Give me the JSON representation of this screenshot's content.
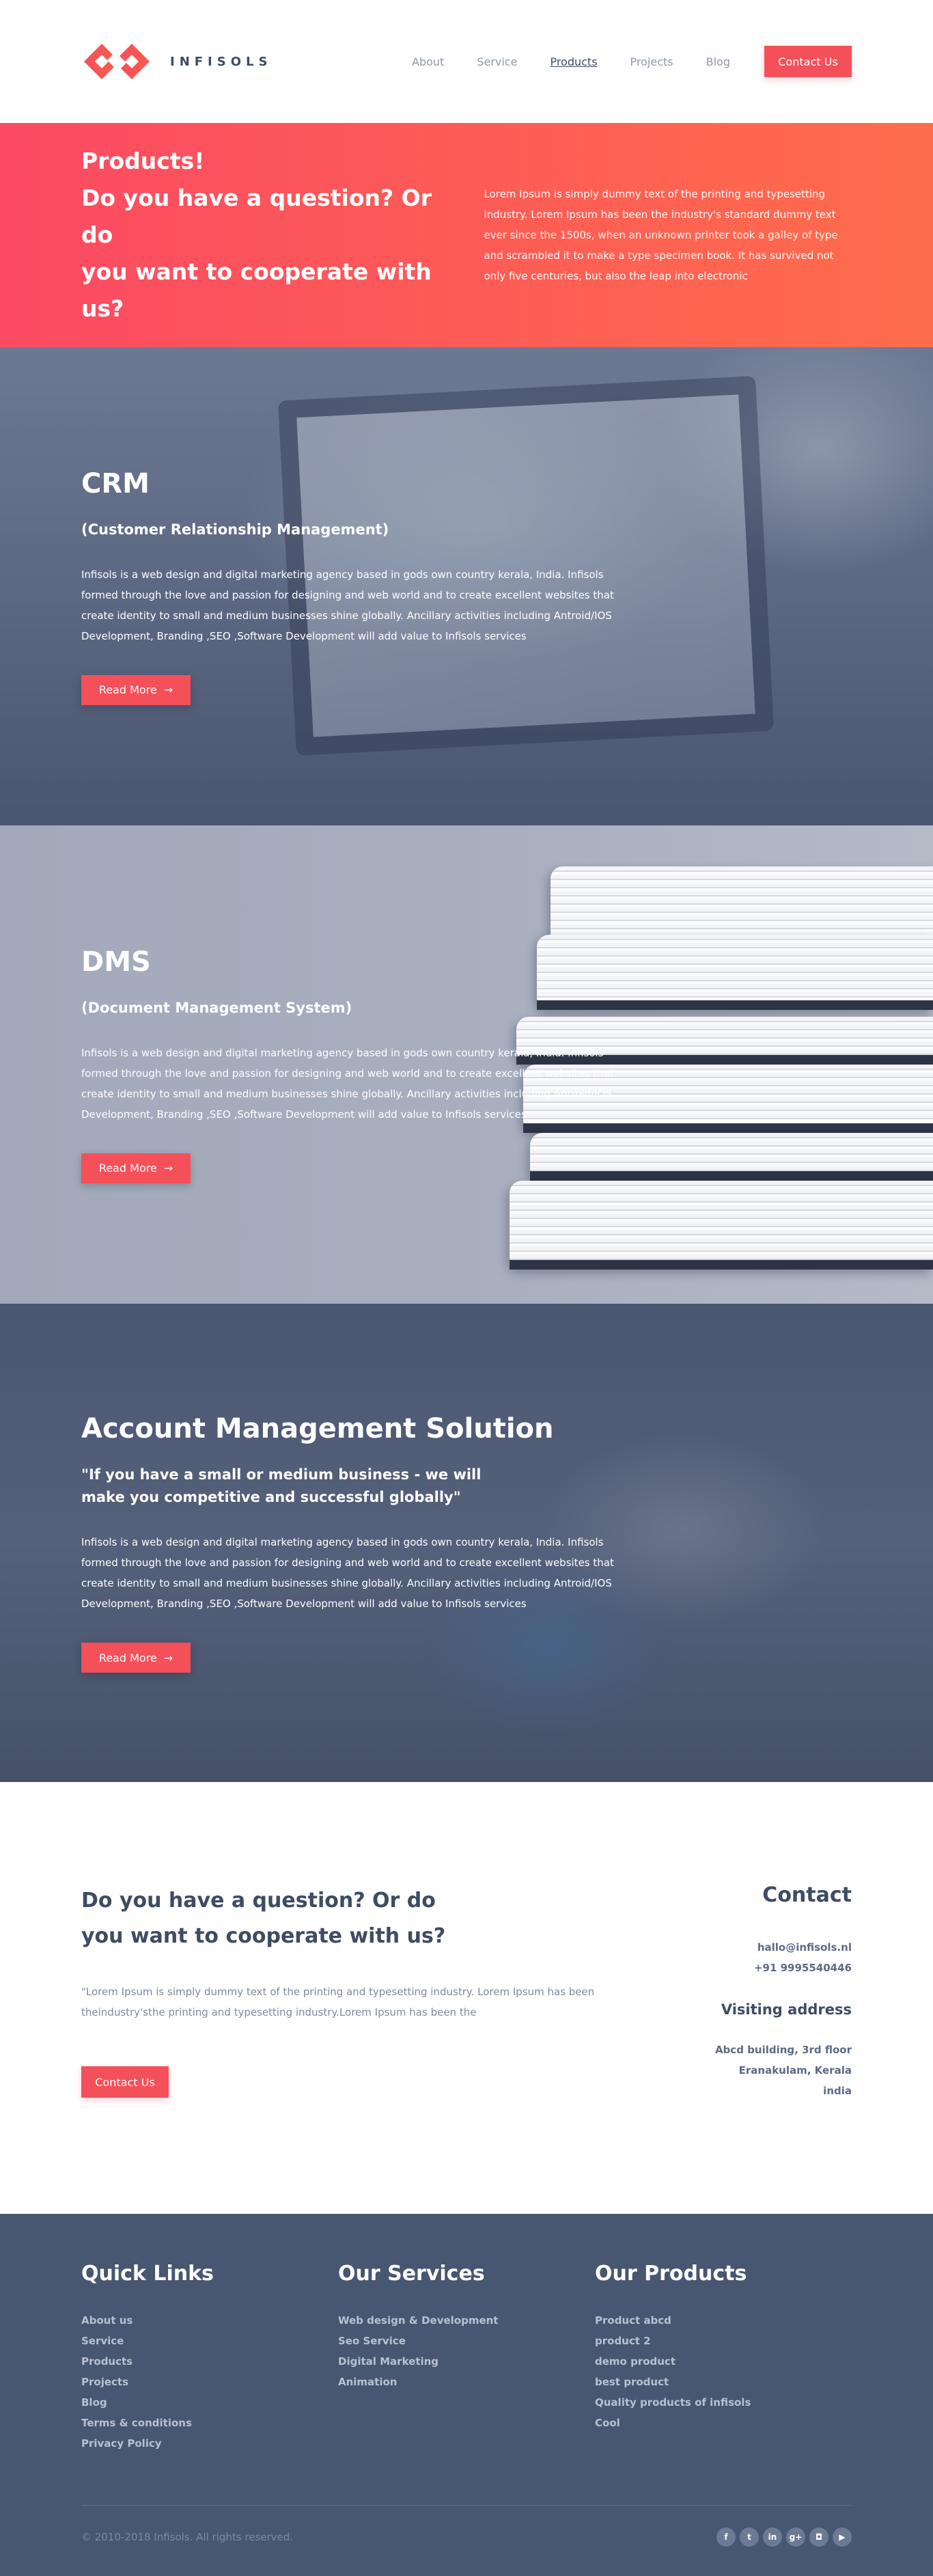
{
  "brand": {
    "name": "INFISOLS",
    "accent": "#f4505a"
  },
  "nav": {
    "items": [
      {
        "label": "About"
      },
      {
        "label": "Service"
      },
      {
        "label": "Products"
      },
      {
        "label": "Projects"
      },
      {
        "label": "Blog"
      }
    ],
    "active": "Products",
    "contact_label": "Contact Us"
  },
  "hero": {
    "title_line1": "Products!",
    "title_line2": "Do you have a question? Or do",
    "title_line3": "you want to cooperate with us?",
    "text": "Lorem Ipsum is simply dummy text of the printing and typesetting industry. Lorem Ipsum has been the industry's standard dummy text ever since the 1500s, when an unknown printer took a galley of type and scrambled it to make a type specimen book. It has survived not only five centuries, but also the leap into electronic"
  },
  "products": [
    {
      "title": "CRM",
      "subtitle": "(Customer Relationship Management)",
      "description": "Infisols is a web design and digital marketing agency based in gods own country kerala, India. Infisols formed through the love and passion for designing and web world and to create excellent websites that create identity to small and medium businesses shine globally. Ancillary activities including Antroid/IOS Development, Branding ,SEO ,Software Development will add value to Infisols services",
      "button": "Read More"
    },
    {
      "title": "DMS",
      "subtitle": "(Document Management System)",
      "description": "Infisols is a web design and digital marketing agency based in gods own country kerala, India. Infisols formed through the love and passion for designing and web world and to create excellent websites that create identity to small and medium businesses shine globally. Ancillary activities including Antroid/IOS Development, Branding ,SEO ,Software Development will add value to Infisols services",
      "button": "Read More"
    },
    {
      "title": "Account Management Solution",
      "subtitle_line1": "\"If you have a small or medium business - we will",
      "subtitle_line2": "make you competitive and successful globally\"",
      "description": "Infisols is a web design and digital marketing agency based in gods own country kerala, India. Infisols formed through the love and passion for designing and web world and to create excellent websites that create identity to small and medium businesses shine globally. Ancillary activities including Antroid/IOS Development, Branding ,SEO ,Software Development will add value to Infisols services",
      "button": "Read More"
    }
  ],
  "question": {
    "title_line1": "Do you have a question? Or do",
    "title_line2": "you want to cooperate with us?",
    "text": "\"Lorem Ipsum is simply dummy text of the printing and typesetting industry. Lorem Ipsum has been theindustry'sthe printing and typesetting industry.Lorem Ipsum has been the",
    "button": "Contact Us"
  },
  "contact": {
    "title": "Contact",
    "email": "hallo@infisols.nl",
    "phone": "+91  9995540446",
    "visiting_title": "Visiting address",
    "address_line1": "Abcd building, 3rd floor",
    "address_line2": "Eranakulam, Kerala",
    "address_line3": "india"
  },
  "footer": {
    "quick_links": {
      "title": "Quick Links",
      "items": [
        "About us",
        "Service",
        "Products",
        "Projects",
        "Blog",
        "Terms & conditions",
        "Privacy Policy"
      ]
    },
    "services": {
      "title": "Our Services",
      "items": [
        "Web design & Development",
        "Seo Service",
        "Digital Marketing",
        "Animation"
      ]
    },
    "products": {
      "title": "Our Products",
      "items": [
        "Product abcd",
        "product 2",
        "demo product",
        "best product",
        "Quality products of infisols",
        "Cool"
      ]
    },
    "copyright": "© 2010-2018 Infisols. All rights reserved.",
    "socials": [
      {
        "icon": "facebook-icon",
        "glyph": "f"
      },
      {
        "icon": "twitter-icon",
        "glyph": "t"
      },
      {
        "icon": "linkedin-icon",
        "glyph": "in"
      },
      {
        "icon": "google-plus-icon",
        "glyph": "g+"
      },
      {
        "icon": "instagram-icon",
        "glyph": "◘"
      },
      {
        "icon": "youtube-icon",
        "glyph": "▶"
      }
    ]
  }
}
